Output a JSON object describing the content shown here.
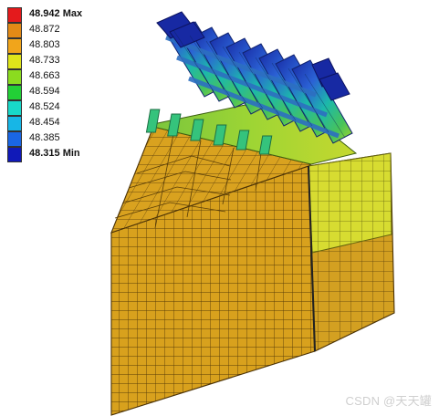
{
  "legend": {
    "entries": [
      {
        "label": "48.942 Max",
        "color": "#e41a1c",
        "bold": true
      },
      {
        "label": "48.872",
        "color": "#e38a16",
        "bold": false
      },
      {
        "label": "48.803",
        "color": "#f1a51b",
        "bold": false
      },
      {
        "label": "48.733",
        "color": "#dfe51a",
        "bold": false
      },
      {
        "label": "48.663",
        "color": "#8bdc1f",
        "bold": false
      },
      {
        "label": "48.594",
        "color": "#22d036",
        "bold": false
      },
      {
        "label": "48.524",
        "color": "#18d8c8",
        "bold": false
      },
      {
        "label": "48.454",
        "color": "#17b6e6",
        "bold": false
      },
      {
        "label": "48.385",
        "color": "#1a66e4",
        "bold": false
      },
      {
        "label": "48.315 Min",
        "color": "#1019b8",
        "bold": true
      }
    ]
  },
  "watermark": {
    "text": "CSDN @天天罐"
  },
  "colors": {
    "body_orange": "#d8a11d",
    "body_orange_dark": "#cc9413",
    "top_orange": "#d9a21f",
    "side_yellow": "#d7dc31",
    "side_yellow_light": "#e6e75f",
    "green": "#48c35a",
    "teal": "#1cb8aa",
    "blue": "#2b62d5",
    "dark_blue": "#1729a3"
  }
}
